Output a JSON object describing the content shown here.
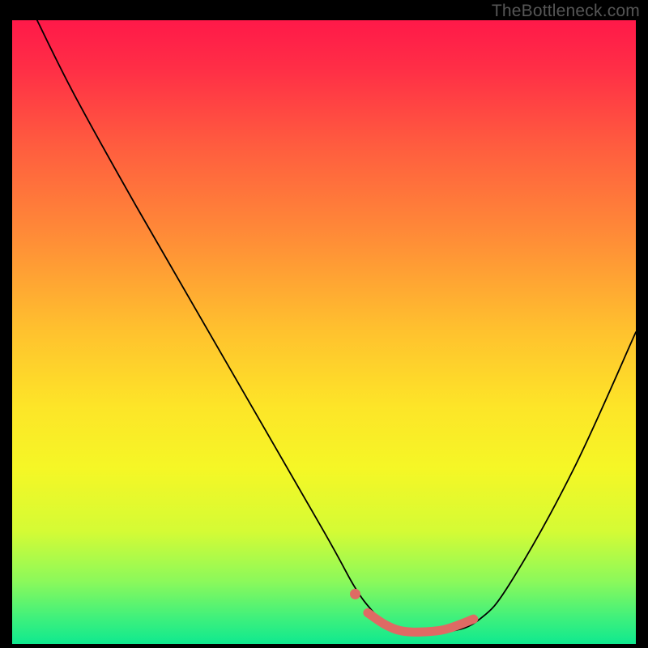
{
  "watermark": "TheBottleneck.com",
  "chart_data": {
    "type": "line",
    "title": "",
    "xlabel": "",
    "ylabel": "",
    "xlim": [
      0,
      100
    ],
    "ylim": [
      0,
      100
    ],
    "grid": false,
    "legend": false,
    "series": [
      {
        "name": "curve",
        "x": [
          4,
          10,
          20,
          35,
          50,
          55,
          58,
          60,
          63,
          70,
          75,
          80,
          90,
          100
        ],
        "y": [
          100,
          88,
          70,
          44,
          18,
          9,
          5,
          3,
          2,
          2,
          4,
          10,
          28,
          50
        ],
        "notes": "Approximate asymmetric V-shaped curve; steep descent from upper-left, near-flat minimum around x≈63–70, gentler rise to right edge reaching about y≈50."
      },
      {
        "name": "highlight-segment",
        "x": [
          57,
          60,
          63,
          67,
          70,
          74
        ],
        "y": [
          5,
          3,
          2,
          2,
          2.5,
          4
        ],
        "notes": "Thick coral stroke segment along the trough of the curve."
      },
      {
        "name": "highlight-dot",
        "x": [
          55
        ],
        "y": [
          8
        ],
        "notes": "Isolated coral dot just left of the highlight segment."
      }
    ],
    "gradient_stops": [
      {
        "offset": 0.0,
        "color": "#ff1949"
      },
      {
        "offset": 0.08,
        "color": "#ff2f46"
      },
      {
        "offset": 0.2,
        "color": "#ff5c3f"
      },
      {
        "offset": 0.35,
        "color": "#ff8d37"
      },
      {
        "offset": 0.5,
        "color": "#ffc22e"
      },
      {
        "offset": 0.62,
        "color": "#fde528"
      },
      {
        "offset": 0.72,
        "color": "#f5f726"
      },
      {
        "offset": 0.82,
        "color": "#d4fb35"
      },
      {
        "offset": 0.9,
        "color": "#8bf95b"
      },
      {
        "offset": 0.96,
        "color": "#3df07d"
      },
      {
        "offset": 1.0,
        "color": "#0fe98f"
      }
    ],
    "colors": {
      "background": "#000000",
      "curve": "#000000",
      "highlight": "#df6a64",
      "watermark": "#565656"
    }
  }
}
